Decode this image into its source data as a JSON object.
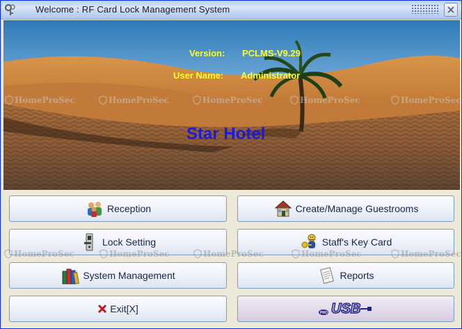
{
  "window": {
    "title": "Welcome :  RF Card Lock Management System"
  },
  "banner": {
    "version_label": "Version:",
    "version_value": "PCLMS-V9.29",
    "user_label": "User Name:",
    "user_value": "Administrator",
    "hotel_name": "Star Hotel"
  },
  "watermark": "HomeProSec",
  "buttons": {
    "reception": "Reception",
    "guestrooms": "Create/Manage Guestrooms",
    "lock_setting": "Lock Setting",
    "staff_card": "Staff's Key Card",
    "system_management": "System Management",
    "reports": "Reports",
    "exit": "Exit[X]",
    "usb": "USB"
  },
  "icons": {
    "app": "key-icon",
    "close": "close-icon",
    "reception": "people-icon",
    "guestrooms": "house-icon",
    "lock_setting": "door-lock-icon",
    "staff_card": "staff-key-icon",
    "system_management": "books-icon",
    "reports": "notepad-icon",
    "exit": "x-icon",
    "usb": "usb-icon"
  },
  "colors": {
    "accent_yellow": "#ffff22",
    "hotel_blue": "#1a1ae0",
    "title_bar": "#c7d8f4"
  }
}
